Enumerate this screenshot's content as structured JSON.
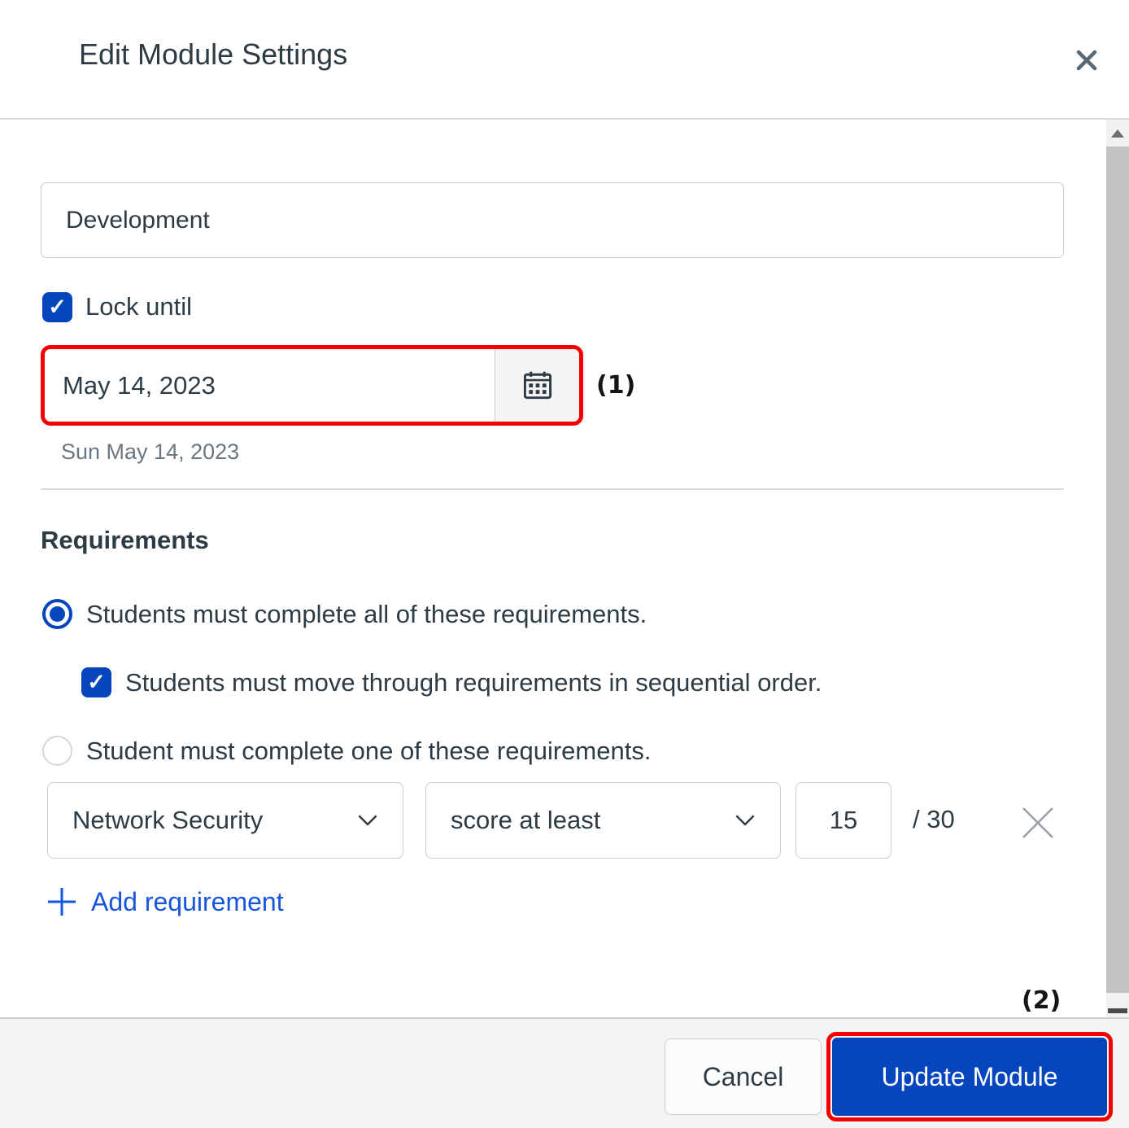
{
  "dialog": {
    "title": "Edit Module Settings"
  },
  "form": {
    "module_name": {
      "value": "Development"
    },
    "lock_until": {
      "label": "Lock until",
      "checked": true,
      "check_glyph": "✓"
    },
    "date_field": {
      "value": "May 14, 2023",
      "helper": "Sun May 14, 2023",
      "annotation": "(1)"
    },
    "requirements": {
      "heading": "Requirements",
      "radio_all_label": "Students must complete all of these requirements.",
      "checkbox_sequential_label": "Students must move through requirements in sequential order.",
      "checkbox_sequential_glyph": "✓",
      "radio_one_label": "Student must complete one of these requirements.",
      "row": {
        "module_item": "Network Security",
        "requirement_type": "score at least",
        "score": "15",
        "out_of": "/ 30"
      },
      "add_link_label": "Add requirement"
    }
  },
  "footer": {
    "annotation": "(2)",
    "cancel_label": "Cancel",
    "update_label": "Update Module"
  },
  "icons": {
    "close": "close-icon",
    "calendar": "calendar-icon",
    "chevron": "chevron-down-icon",
    "remove": "remove-icon",
    "plus": "plus-icon"
  },
  "colors": {
    "accent_blue": "#0545BE",
    "link_blue": "#1656DC",
    "highlight_red": "#F50000",
    "text": "#2D3B45",
    "muted_text": "#6B7780",
    "border": "#C7CDD1",
    "footer_bg": "#F4F4F4"
  }
}
